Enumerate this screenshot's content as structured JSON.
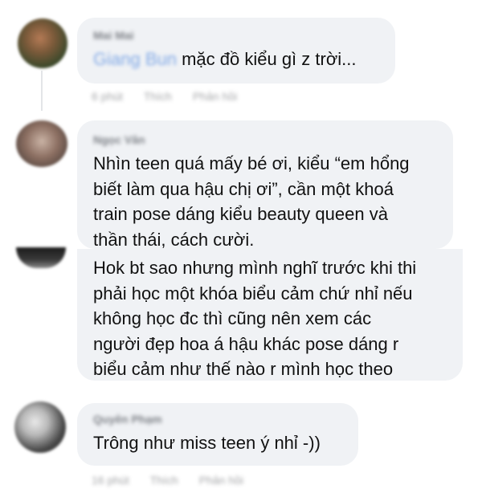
{
  "comments": [
    {
      "author": "Mai Mai",
      "mention": "Giang Bun",
      "text": "mặc đồ kiểu gì z trời...",
      "meta": {
        "time": "6 phút",
        "like": "Thích",
        "reply": "Phản hồi"
      }
    },
    {
      "author": "Ngọc Vân",
      "lines": [
        "Nhìn teen quá mấy bé ơi, kiểu “em hổng",
        "biết làm qua hậu chị ơi”, cần một khoá",
        "train pose dáng kiểu beauty queen và",
        "thần thái, cách cười."
      ]
    },
    {
      "lines": [
        "Hok bt sao nhưng mình nghĩ trước khi thi",
        "phải học một khóa biểu cảm chứ nhỉ nếu",
        "không học đc thì cũng nên xem các",
        "người đẹp hoa á hậu khác pose dáng r",
        "biểu cảm như thế nào r mình học theo"
      ]
    },
    {
      "author": "Quyên Phạm",
      "text": "Trông như miss teen ý nhỉ -))",
      "meta": {
        "time": "16 phút",
        "like": "Thích",
        "reply": "Phản hồi"
      }
    }
  ]
}
